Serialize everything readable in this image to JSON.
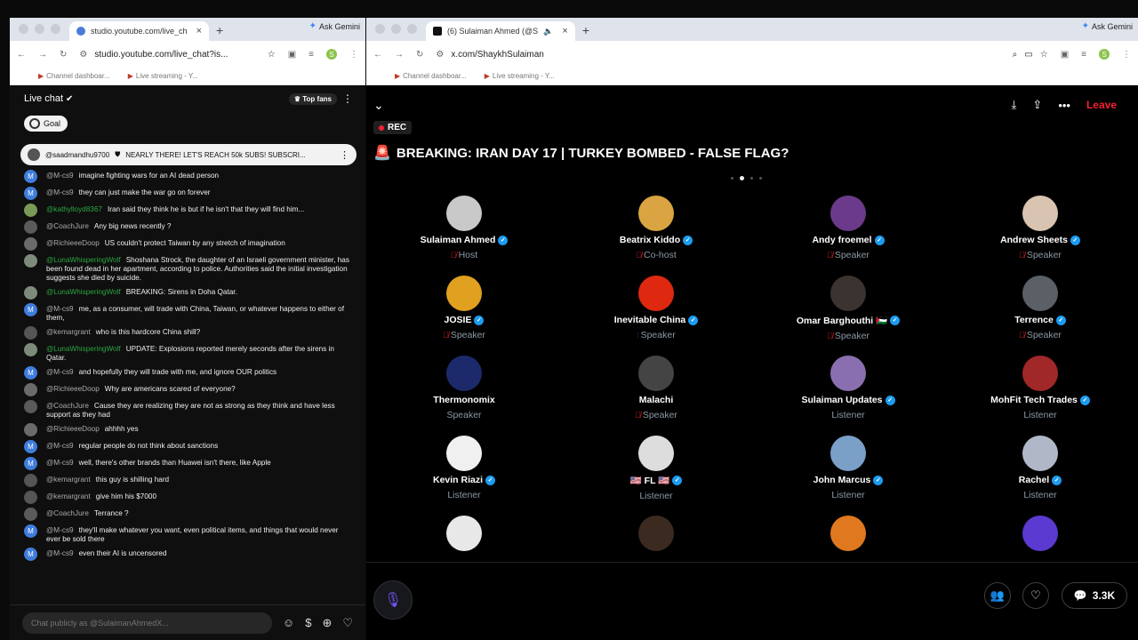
{
  "left_window": {
    "tab_title": "studio.youtube.com/live_ch",
    "ask_gemini": "Ask Gemini",
    "url": "studio.youtube.com/live_chat?is...",
    "bookmarks": [
      "Channel dashboar...",
      "Live streaming - Y..."
    ],
    "profile_letter": "S"
  },
  "right_window": {
    "tab_title": "(6) Sulaiman Ahmed (@S",
    "ask_gemini": "Ask Gemini",
    "url": "x.com/ShaykhSulaiman",
    "bookmarks": [
      "Channel dashboar...",
      "Live streaming - Y..."
    ],
    "profile_letter": "S"
  },
  "chat": {
    "title": "Live chat",
    "top_fans": "Top fans",
    "goal": "Goal",
    "pinned": {
      "author": "@saadmandhu9700",
      "text": "NEARLY THERE! LET'S REACH 50k SUBS! SUBSCRI..."
    },
    "messages": [
      {
        "author": "@M-cs9",
        "text": "imagine fighting wars for an AI dead person",
        "avatar": "M",
        "color": "#3f7ddc",
        "green": false
      },
      {
        "author": "@M-cs9",
        "text": "they can just make the war go on forever",
        "avatar": "M",
        "color": "#3f7ddc",
        "green": false
      },
      {
        "author": "@kathylloyd8367",
        "text": "Iran said they think he is but if he isn't that they will find him...",
        "avatar": "",
        "color": "#7a9a55",
        "green": true
      },
      {
        "author": "@CoachJure",
        "text": "Any big news recently ?",
        "avatar": "",
        "color": "#5a5a5a",
        "green": false
      },
      {
        "author": "@RichieeeDoop",
        "text": "US couldn't protect Taiwan by any stretch of imagination",
        "avatar": "",
        "color": "#6a6a6a",
        "green": false
      },
      {
        "author": "@LunaWhisperingWolf",
        "text": "Shoshana Strock, the daughter of an Israeli government minister, has been found dead in her apartment, according to police. Authorities said the initial investigation suggests she died by suicide.",
        "avatar": "",
        "color": "#7d8c7a",
        "green": true
      },
      {
        "author": "@LunaWhisperingWolf",
        "text": "BREAKING: Sirens in Doha Qatar.",
        "avatar": "",
        "color": "#7d8c7a",
        "green": true
      },
      {
        "author": "@M-cs9",
        "text": "me, as a consumer, will trade with China, Taiwan, or whatever happens to either of them,",
        "avatar": "M",
        "color": "#3f7ddc",
        "green": false
      },
      {
        "author": "@kemargrant",
        "text": "who is this hardcore China shill?",
        "avatar": "",
        "color": "#555",
        "green": false
      },
      {
        "author": "@LunaWhisperingWolf",
        "text": "UPDATE: Explosions reported merely seconds after the sirens in Qatar.",
        "avatar": "",
        "color": "#7d8c7a",
        "green": true
      },
      {
        "author": "@M-cs9",
        "text": "and hopefully they will trade with me, and ignore OUR politics",
        "avatar": "M",
        "color": "#3f7ddc",
        "green": false
      },
      {
        "author": "@RichieeeDoop",
        "text": "Why are americans scared of everyone?",
        "avatar": "",
        "color": "#6a6a6a",
        "green": false
      },
      {
        "author": "@CoachJure",
        "text": "Cause they are realizing they are not as strong as they think and have less support as they had",
        "avatar": "",
        "color": "#5a5a5a",
        "green": false
      },
      {
        "author": "@RichieeeDoop",
        "text": "ahhhh yes",
        "avatar": "",
        "color": "#6a6a6a",
        "green": false
      },
      {
        "author": "@M-cs9",
        "text": "regular people do not think about sanctions",
        "avatar": "M",
        "color": "#3f7ddc",
        "green": false
      },
      {
        "author": "@M-cs9",
        "text": "well, there's other brands than Huawei isn't there, like Apple",
        "avatar": "M",
        "color": "#3f7ddc",
        "green": false
      },
      {
        "author": "@kemargrant",
        "text": "this guy is shilling hard",
        "avatar": "",
        "color": "#555",
        "green": false
      },
      {
        "author": "@kemargrant",
        "text": "give him his $7000",
        "avatar": "",
        "color": "#555",
        "green": false
      },
      {
        "author": "@CoachJure",
        "text": "Terrance ?",
        "avatar": "",
        "color": "#5a5a5a",
        "green": false
      },
      {
        "author": "@M-cs9",
        "text": "they'll make whatever you want, even political items, and things that would never ever be sold there",
        "avatar": "M",
        "color": "#3f7ddc",
        "green": false
      },
      {
        "author": "@M-cs9",
        "text": "even their AI is uncensored",
        "avatar": "M",
        "color": "#3f7ddc",
        "green": false
      }
    ],
    "input_placeholder": "Chat publicly as @SulaimanAhmedX...",
    "badge_count": "5"
  },
  "space": {
    "rec": "REC",
    "title": "BREAKING: IRAN DAY 17 | TURKEY BOMBED - FALSE FLAG?",
    "leave": "Leave",
    "comments_count": "3.3K",
    "people": [
      {
        "name": "Sulaiman Ahmed",
        "role": "Host",
        "verified": true,
        "state": "muted",
        "color": "#c9c9c9"
      },
      {
        "name": "Beatrix Kiddo",
        "role": "Co-host",
        "verified": true,
        "state": "muted",
        "color": "#d9a441"
      },
      {
        "name": "Andy froemel",
        "role": "Speaker",
        "verified": true,
        "state": "muted",
        "color": "#6b3a8a"
      },
      {
        "name": "Andrew Sheets",
        "role": "Speaker",
        "verified": true,
        "state": "muted",
        "color": "#d8c4b0"
      },
      {
        "name": "JOSIE",
        "role": "Speaker",
        "verified": true,
        "state": "muted",
        "color": "#e0a020"
      },
      {
        "name": "Inevitable China",
        "role": "Speaker",
        "verified": true,
        "state": "talking",
        "color": "#de2910"
      },
      {
        "name": "Omar Barghouthi 🇵🇸",
        "role": "Speaker",
        "verified": true,
        "state": "muted",
        "color": "#3a3330"
      },
      {
        "name": "Terrence",
        "role": "Speaker",
        "verified": true,
        "state": "muted",
        "color": "#5a6066"
      },
      {
        "name": "Thermonomix",
        "role": "Speaker",
        "verified": false,
        "state": "none",
        "color": "#1c2a6b"
      },
      {
        "name": "Malachi",
        "role": "Speaker",
        "verified": false,
        "state": "muted",
        "color": "#444"
      },
      {
        "name": "Sulaiman Updates",
        "role": "Listener",
        "verified": true,
        "state": "none",
        "color": "#8a6fb0"
      },
      {
        "name": "MohFit Tech Trades",
        "role": "Listener",
        "verified": true,
        "state": "none",
        "color": "#a02828"
      },
      {
        "name": "Kevin Riazi",
        "role": "Listener",
        "verified": true,
        "state": "none",
        "color": "#f0f0f0"
      },
      {
        "name": "🇺🇸 FL 🇺🇸",
        "role": "Listener",
        "verified": true,
        "state": "none",
        "color": "#ddd"
      },
      {
        "name": "John Marcus",
        "role": "Listener",
        "verified": true,
        "state": "none",
        "color": "#7aa0c8"
      },
      {
        "name": "Rachel",
        "role": "Listener",
        "verified": true,
        "state": "none",
        "color": "#b0b8c8"
      },
      {
        "name": "",
        "role": "",
        "verified": false,
        "state": "none",
        "color": "#e8e8e8"
      },
      {
        "name": "",
        "role": "",
        "verified": false,
        "state": "none",
        "color": "#3a2a20"
      },
      {
        "name": "",
        "role": "",
        "verified": false,
        "state": "none",
        "color": "#e07820"
      },
      {
        "name": "",
        "role": "",
        "verified": false,
        "state": "none",
        "color": "#5a3ad0"
      }
    ]
  }
}
